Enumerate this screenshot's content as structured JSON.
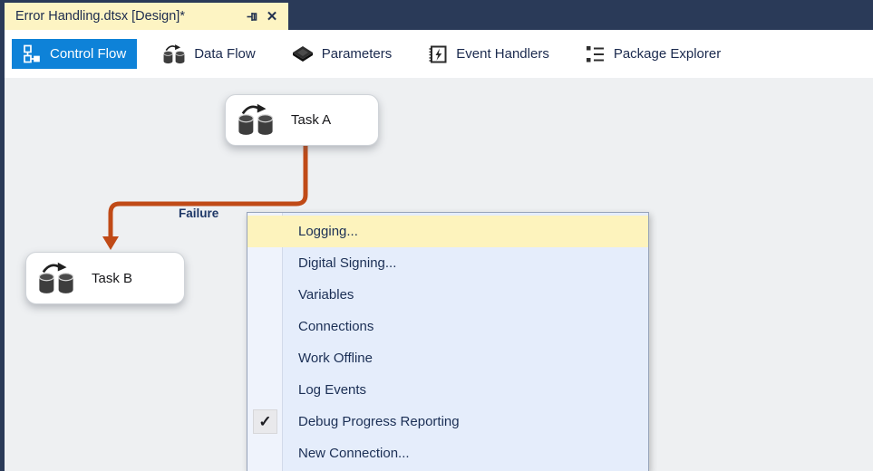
{
  "tab": {
    "title": "Error Handling.dtsx [Design]*",
    "close_glyph": "✕"
  },
  "toolbar": {
    "items": [
      {
        "label": "Control Flow",
        "active": true
      },
      {
        "label": "Data Flow",
        "active": false
      },
      {
        "label": "Parameters",
        "active": false
      },
      {
        "label": "Event Handlers",
        "active": false
      },
      {
        "label": "Package Explorer",
        "active": false
      }
    ]
  },
  "canvas": {
    "tasks": [
      {
        "label": "Task A"
      },
      {
        "label": "Task B"
      }
    ],
    "connector": {
      "label": "Failure",
      "type": "failure-precedence-constraint",
      "color": "#c04a17"
    }
  },
  "context_menu": {
    "check_glyph": "✓",
    "items": [
      {
        "label": "Logging...",
        "highlighted": true,
        "checked": false
      },
      {
        "label": "Digital Signing...",
        "highlighted": false,
        "checked": false
      },
      {
        "label": "Variables",
        "highlighted": false,
        "checked": false
      },
      {
        "label": "Connections",
        "highlighted": false,
        "checked": false
      },
      {
        "label": "Work Offline",
        "highlighted": false,
        "checked": false
      },
      {
        "label": "Log Events",
        "highlighted": false,
        "checked": false
      },
      {
        "label": "Debug Progress Reporting",
        "highlighted": false,
        "checked": true
      },
      {
        "label": "New Connection...",
        "highlighted": false,
        "checked": false
      }
    ]
  },
  "colors": {
    "header_bg": "#2a3a58",
    "tab_bg": "#fdf4c3",
    "accent_blue": "#0e82d8",
    "surface_bg": "#eef0f2",
    "menu_bg": "#e5edfb",
    "menu_highlight": "#fdf3bd",
    "connector": "#c04a17",
    "text_dark": "#1b2a4e"
  }
}
